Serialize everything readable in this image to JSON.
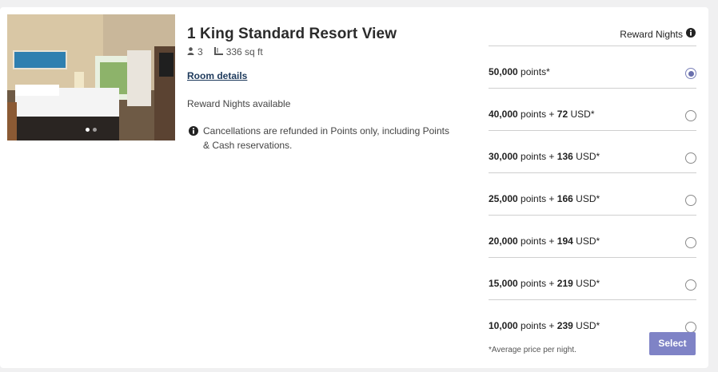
{
  "room": {
    "title": "1 King Standard Resort View",
    "guests": "3",
    "size": "336 sq ft",
    "details_link": "Room details",
    "availability": "Reward Nights available",
    "cancellation_notice": "Cancellations are refunded in Points only, including Points & Cash reservations."
  },
  "photo": {
    "slides": 2,
    "active_slide": 1
  },
  "rates": {
    "heading": "Reward Nights",
    "options": [
      {
        "points": "50,000",
        "points_word": "points*",
        "cash_prefix": "",
        "cash": "",
        "currency": "",
        "selected": true
      },
      {
        "points": "40,000",
        "points_word": "points",
        "cash_prefix": "+",
        "cash": "72",
        "currency": "USD*",
        "selected": false
      },
      {
        "points": "30,000",
        "points_word": "points",
        "cash_prefix": "+",
        "cash": "136",
        "currency": "USD*",
        "selected": false
      },
      {
        "points": "25,000",
        "points_word": "points",
        "cash_prefix": "+",
        "cash": "166",
        "currency": "USD*",
        "selected": false
      },
      {
        "points": "20,000",
        "points_word": "points",
        "cash_prefix": "+",
        "cash": "194",
        "currency": "USD*",
        "selected": false
      },
      {
        "points": "15,000",
        "points_word": "points",
        "cash_prefix": "+",
        "cash": "219",
        "currency": "USD*",
        "selected": false
      },
      {
        "points": "10,000",
        "points_word": "points",
        "cash_prefix": "+",
        "cash": "239",
        "currency": "USD*",
        "selected": false
      }
    ],
    "footnote": "*Average price per night.",
    "select_label": "Select"
  },
  "colors": {
    "accent": "#7f83c6",
    "radio_selected": "#6a70ad",
    "link": "#1e3a5c"
  },
  "icons": {
    "guests": "person-icon",
    "size": "floor-area-icon",
    "info": "info-circle-icon"
  }
}
